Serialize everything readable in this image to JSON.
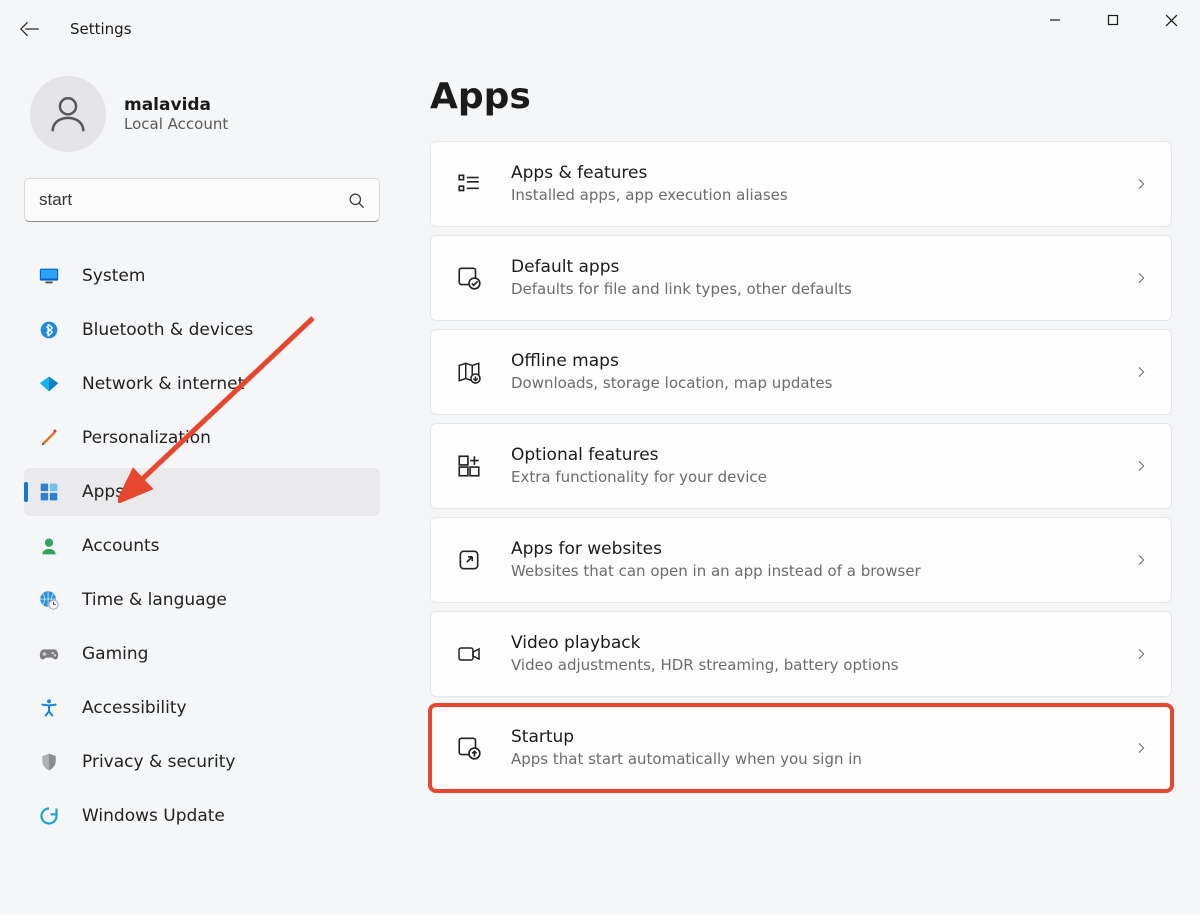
{
  "window": {
    "title": "Settings"
  },
  "account": {
    "name": "malavida",
    "subtitle": "Local Account"
  },
  "search": {
    "value": "start"
  },
  "sidebar": {
    "items": [
      {
        "label": "System"
      },
      {
        "label": "Bluetooth & devices"
      },
      {
        "label": "Network & internet"
      },
      {
        "label": "Personalization"
      },
      {
        "label": "Apps"
      },
      {
        "label": "Accounts"
      },
      {
        "label": "Time & language"
      },
      {
        "label": "Gaming"
      },
      {
        "label": "Accessibility"
      },
      {
        "label": "Privacy & security"
      },
      {
        "label": "Windows Update"
      }
    ]
  },
  "main": {
    "title": "Apps",
    "cards": [
      {
        "title": "Apps & features",
        "subtitle": "Installed apps, app execution aliases"
      },
      {
        "title": "Default apps",
        "subtitle": "Defaults for file and link types, other defaults"
      },
      {
        "title": "Offline maps",
        "subtitle": "Downloads, storage location, map updates"
      },
      {
        "title": "Optional features",
        "subtitle": "Extra functionality for your device"
      },
      {
        "title": "Apps for websites",
        "subtitle": "Websites that can open in an app instead of a browser"
      },
      {
        "title": "Video playback",
        "subtitle": "Video adjustments, HDR streaming, battery options"
      },
      {
        "title": "Startup",
        "subtitle": "Apps that start automatically when you sign in"
      }
    ]
  },
  "annotation": {
    "arrow_color": "#e8472f",
    "highlight_color": "#e8472f",
    "highlighted_card_index": 6
  }
}
